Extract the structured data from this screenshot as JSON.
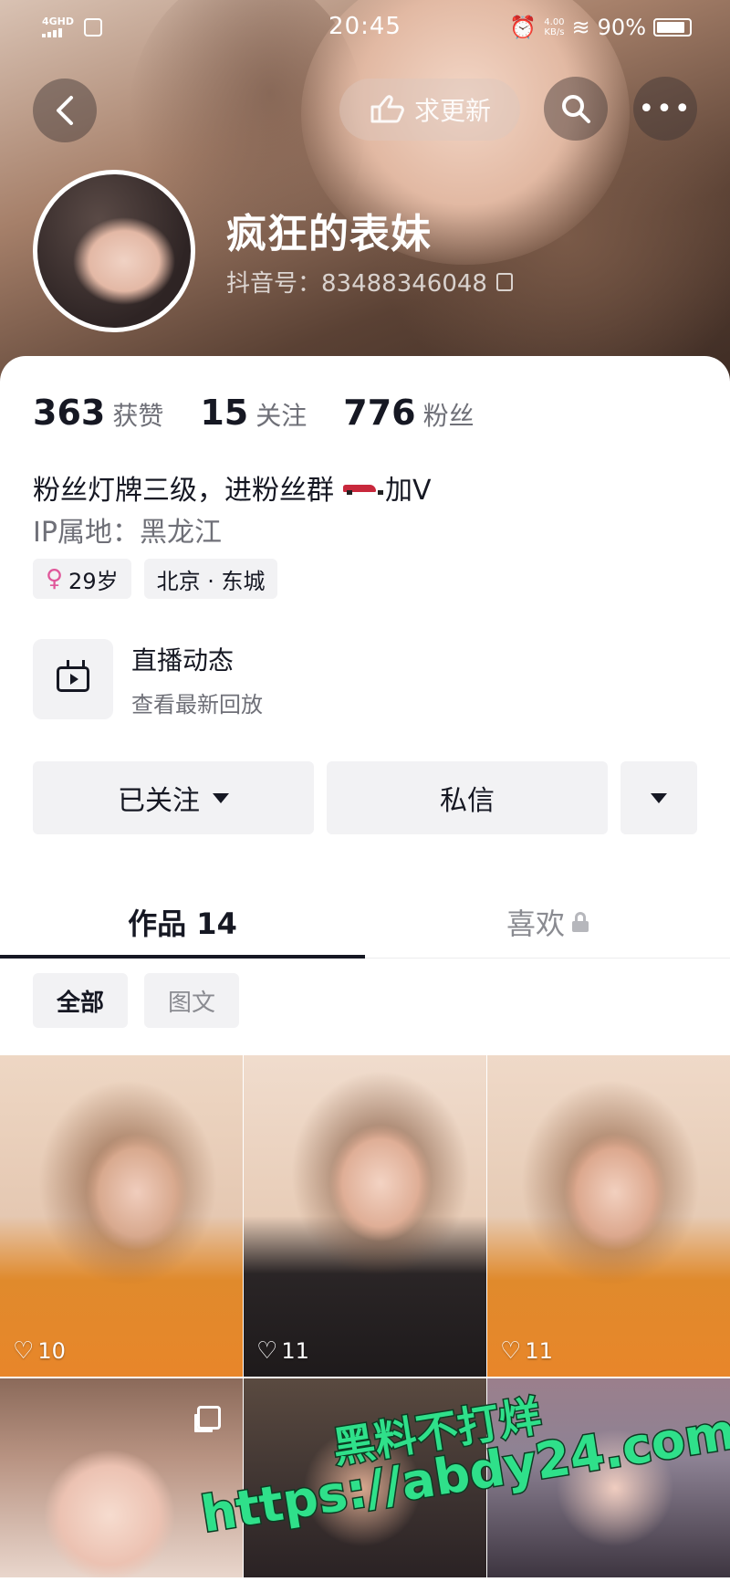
{
  "status_bar": {
    "network": "4GHD",
    "time": "20:45",
    "speed_value": "4.00",
    "speed_unit": "KB/s",
    "battery": "90%"
  },
  "header": {
    "update_button_label": "求更新",
    "back_icon": "back-arrow-icon",
    "search_icon": "search-icon",
    "more_icon": "more-icon",
    "more_glyph": "•••"
  },
  "profile": {
    "nickname": "疯狂的表妹",
    "douyin_id": "抖音号：83488346048",
    "stats": [
      {
        "value": "363",
        "label": "获赞"
      },
      {
        "value": "15",
        "label": "关注"
      },
      {
        "value": "776",
        "label": "粉丝"
      }
    ],
    "bio_text": "粉丝灯牌三级，进粉丝群",
    "bio_suffix": "加V",
    "ip_location": "IP属地：黑龙江",
    "tags": {
      "age": "29岁",
      "location": "北京 · 东城"
    }
  },
  "live": {
    "title": "直播动态",
    "subtitle": "查看最新回放"
  },
  "actions": {
    "follow_label": "已关注",
    "message_label": "私信"
  },
  "tabs": {
    "works_label": "作品 14",
    "likes_label": "喜欢"
  },
  "filters": {
    "all_label": "全部",
    "picture_label": "图文"
  },
  "grid": {
    "items": [
      {
        "likes": "10"
      },
      {
        "likes": "11"
      },
      {
        "likes": "11"
      },
      {
        "likes": ""
      },
      {
        "likes": ""
      },
      {
        "likes": ""
      }
    ]
  },
  "watermark": {
    "line1": "黑料不打烊",
    "line2": "https://abdy24.com"
  },
  "colors": {
    "text_primary": "#161823",
    "text_secondary": "#6f7078",
    "chip_background": "#f2f2f4",
    "female_icon": "#e0579a",
    "watermark": "#2fe08a"
  }
}
